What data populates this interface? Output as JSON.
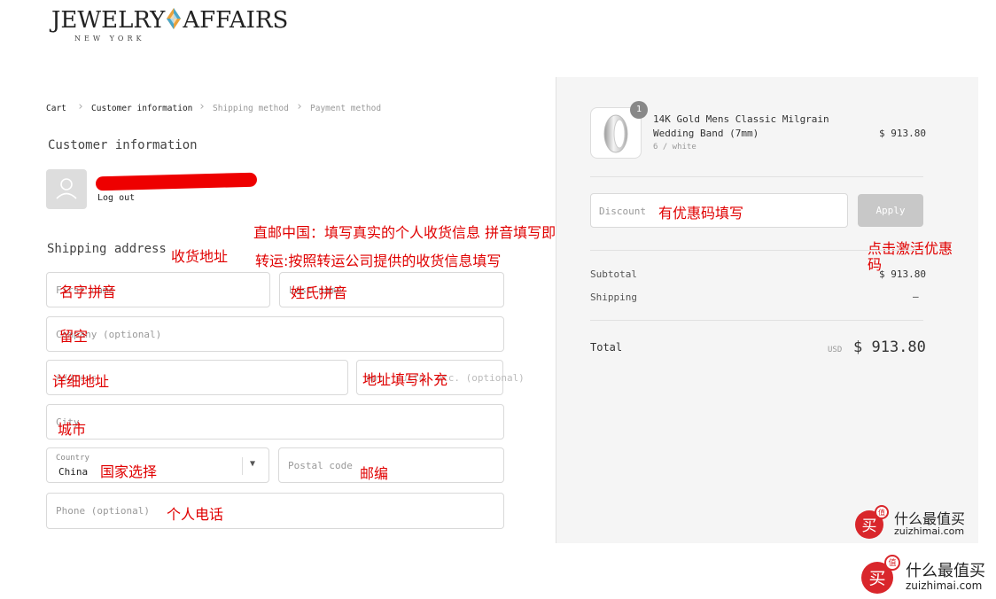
{
  "logo": {
    "brand_left": "JEWELRY",
    "brand_right": "AFFAIRS",
    "location": "NEW YORK"
  },
  "breadcrumb": [
    "Cart",
    "Customer information",
    "Shipping method",
    "Payment method"
  ],
  "customer": {
    "title": "Customer information",
    "logout": "Log out"
  },
  "shipping": {
    "title": "Shipping address",
    "first_name_placeholder": "First name",
    "last_name_placeholder": "Last name",
    "company_placeholder": "Company (optional)",
    "address_placeholder": "Address",
    "apartment_placeholder": "Apt, suite, etc. (optional)",
    "city_placeholder": "City",
    "country_label": "Country",
    "country_value": "China",
    "postal_placeholder": "Postal code",
    "phone_placeholder": "Phone (optional)"
  },
  "annotations": {
    "shipping_address": "收货地址",
    "direct_china": "直邮中国：填写真实的个人收货信息 拼音填写即可",
    "forwarding": "转运:按照转运公司提供的收货信息填写",
    "first_name": "名字拼音",
    "last_name": "姓氏拼音",
    "company": "留空",
    "address": "详细地址",
    "apartment": "地址填写补充",
    "city": "城市",
    "country": "国家选择",
    "postal": "邮编",
    "phone": "个人电话",
    "discount": "有优惠码填写",
    "apply_line1": "点击激活优惠",
    "apply_line2": "码"
  },
  "order": {
    "item_qty": "1",
    "item_name_line1": "14K Gold Mens Classic Milgrain",
    "item_name_line2": "Wedding Band (7mm)",
    "item_variant": "6 / white",
    "item_price": "$ 913.80",
    "discount_placeholder": "Discount",
    "apply_label": "Apply",
    "subtotal_label": "Subtotal",
    "subtotal_value": "$ 913.80",
    "shipping_label": "Shipping",
    "shipping_value": "—",
    "total_label": "Total",
    "total_currency": "USD",
    "total_value": "$ 913.80"
  },
  "watermark": {
    "cn": "什么最值买",
    "en": "zuizhimai.com",
    "badge_char": "买",
    "badge_num": "值"
  },
  "colors": {
    "annotation": "#e00000",
    "redaction": "#e00000",
    "sidebar_bg": "#f5f5f5",
    "apply_bg": "#c8c8c8"
  }
}
